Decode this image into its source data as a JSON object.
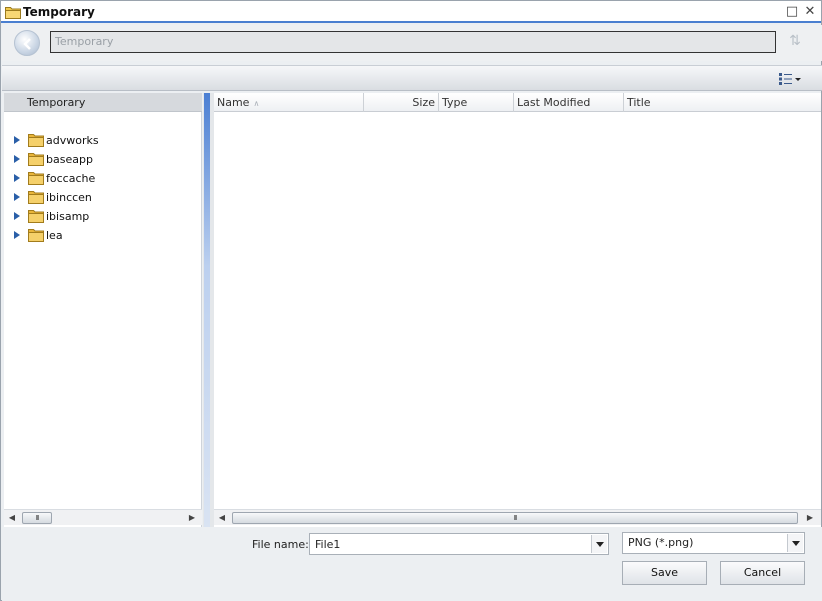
{
  "window": {
    "title": "Temporary",
    "maximize_icon": "maximize-icon",
    "close_icon": "close-icon"
  },
  "nav": {
    "path_placeholder": "Temporary",
    "back_icon": "back-arrow-icon",
    "refresh_icon": "refresh-icon"
  },
  "toolbar": {
    "view_icon": "view-options-icon"
  },
  "left_pane": {
    "header": "Temporary",
    "items": [
      {
        "label": "advworks"
      },
      {
        "label": "baseapp"
      },
      {
        "label": "foccache"
      },
      {
        "label": "ibinccen"
      },
      {
        "label": "ibisamp"
      },
      {
        "label": "lea"
      }
    ]
  },
  "file_list": {
    "columns": [
      {
        "label": "Name"
      },
      {
        "label": "Size"
      },
      {
        "label": "Type"
      },
      {
        "label": "Last Modified"
      },
      {
        "label": "Title"
      }
    ],
    "rows": []
  },
  "scroll": {
    "thumb_grip": "III"
  },
  "footer": {
    "file_name_label": "File name:",
    "file_name_value": "File1",
    "file_type_value": "PNG (*.png)",
    "save_label": "Save",
    "cancel_label": "Cancel"
  },
  "colors": {
    "accent": "#4a7fd0",
    "folder": "#e8b73a"
  }
}
